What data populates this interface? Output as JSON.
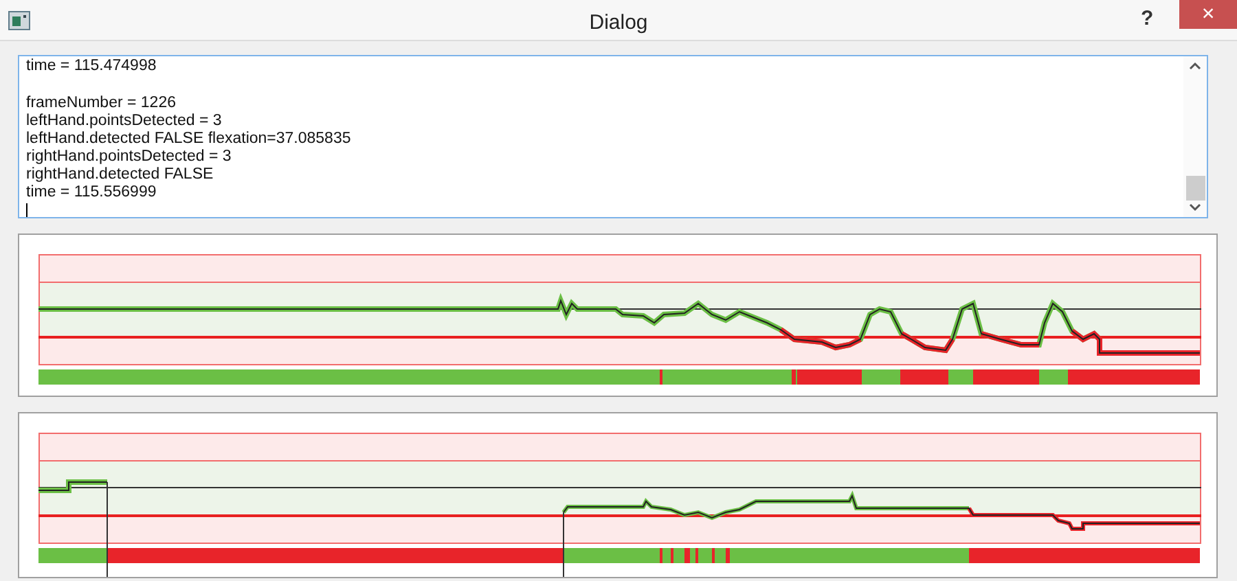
{
  "window": {
    "title": "Dialog",
    "help": "?",
    "close": "×"
  },
  "log": {
    "blocks": [
      [
        "time = 115.474998"
      ],
      [
        "frameNumber = 1226",
        "leftHand.pointsDetected = 3",
        "leftHand.detected FALSE flexation=37.085835",
        "rightHand.pointsDetected = 3",
        "rightHand.detected FALSE",
        "time = 115.556999"
      ]
    ]
  }
}
